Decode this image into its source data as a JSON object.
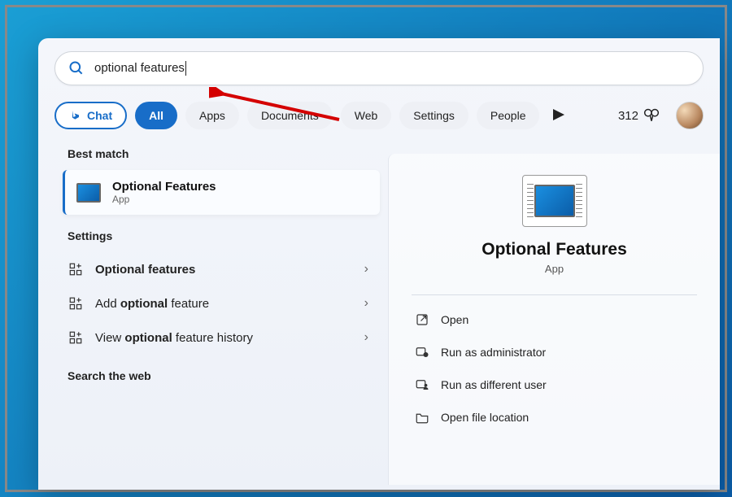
{
  "search": {
    "query": "optional features"
  },
  "filters": {
    "chat": "Chat",
    "all": "All",
    "apps": "Apps",
    "documents": "Documents",
    "web": "Web",
    "settings": "Settings",
    "people": "People"
  },
  "rewards": {
    "points": "312"
  },
  "left": {
    "best_match_label": "Best match",
    "best_match": {
      "title": "Optional Features",
      "subtitle": "App"
    },
    "settings_label": "Settings",
    "settings_items": [
      {
        "pre": "",
        "bold": "Optional features",
        "post": ""
      },
      {
        "pre": "Add ",
        "bold": "optional",
        "post": " feature"
      },
      {
        "pre": "View ",
        "bold": "optional",
        "post": " feature history"
      }
    ],
    "search_web_label": "Search the web"
  },
  "right": {
    "title": "Optional Features",
    "subtitle": "App",
    "actions": {
      "open": "Open",
      "admin": "Run as administrator",
      "diffuser": "Run as different user",
      "location": "Open file location"
    }
  }
}
